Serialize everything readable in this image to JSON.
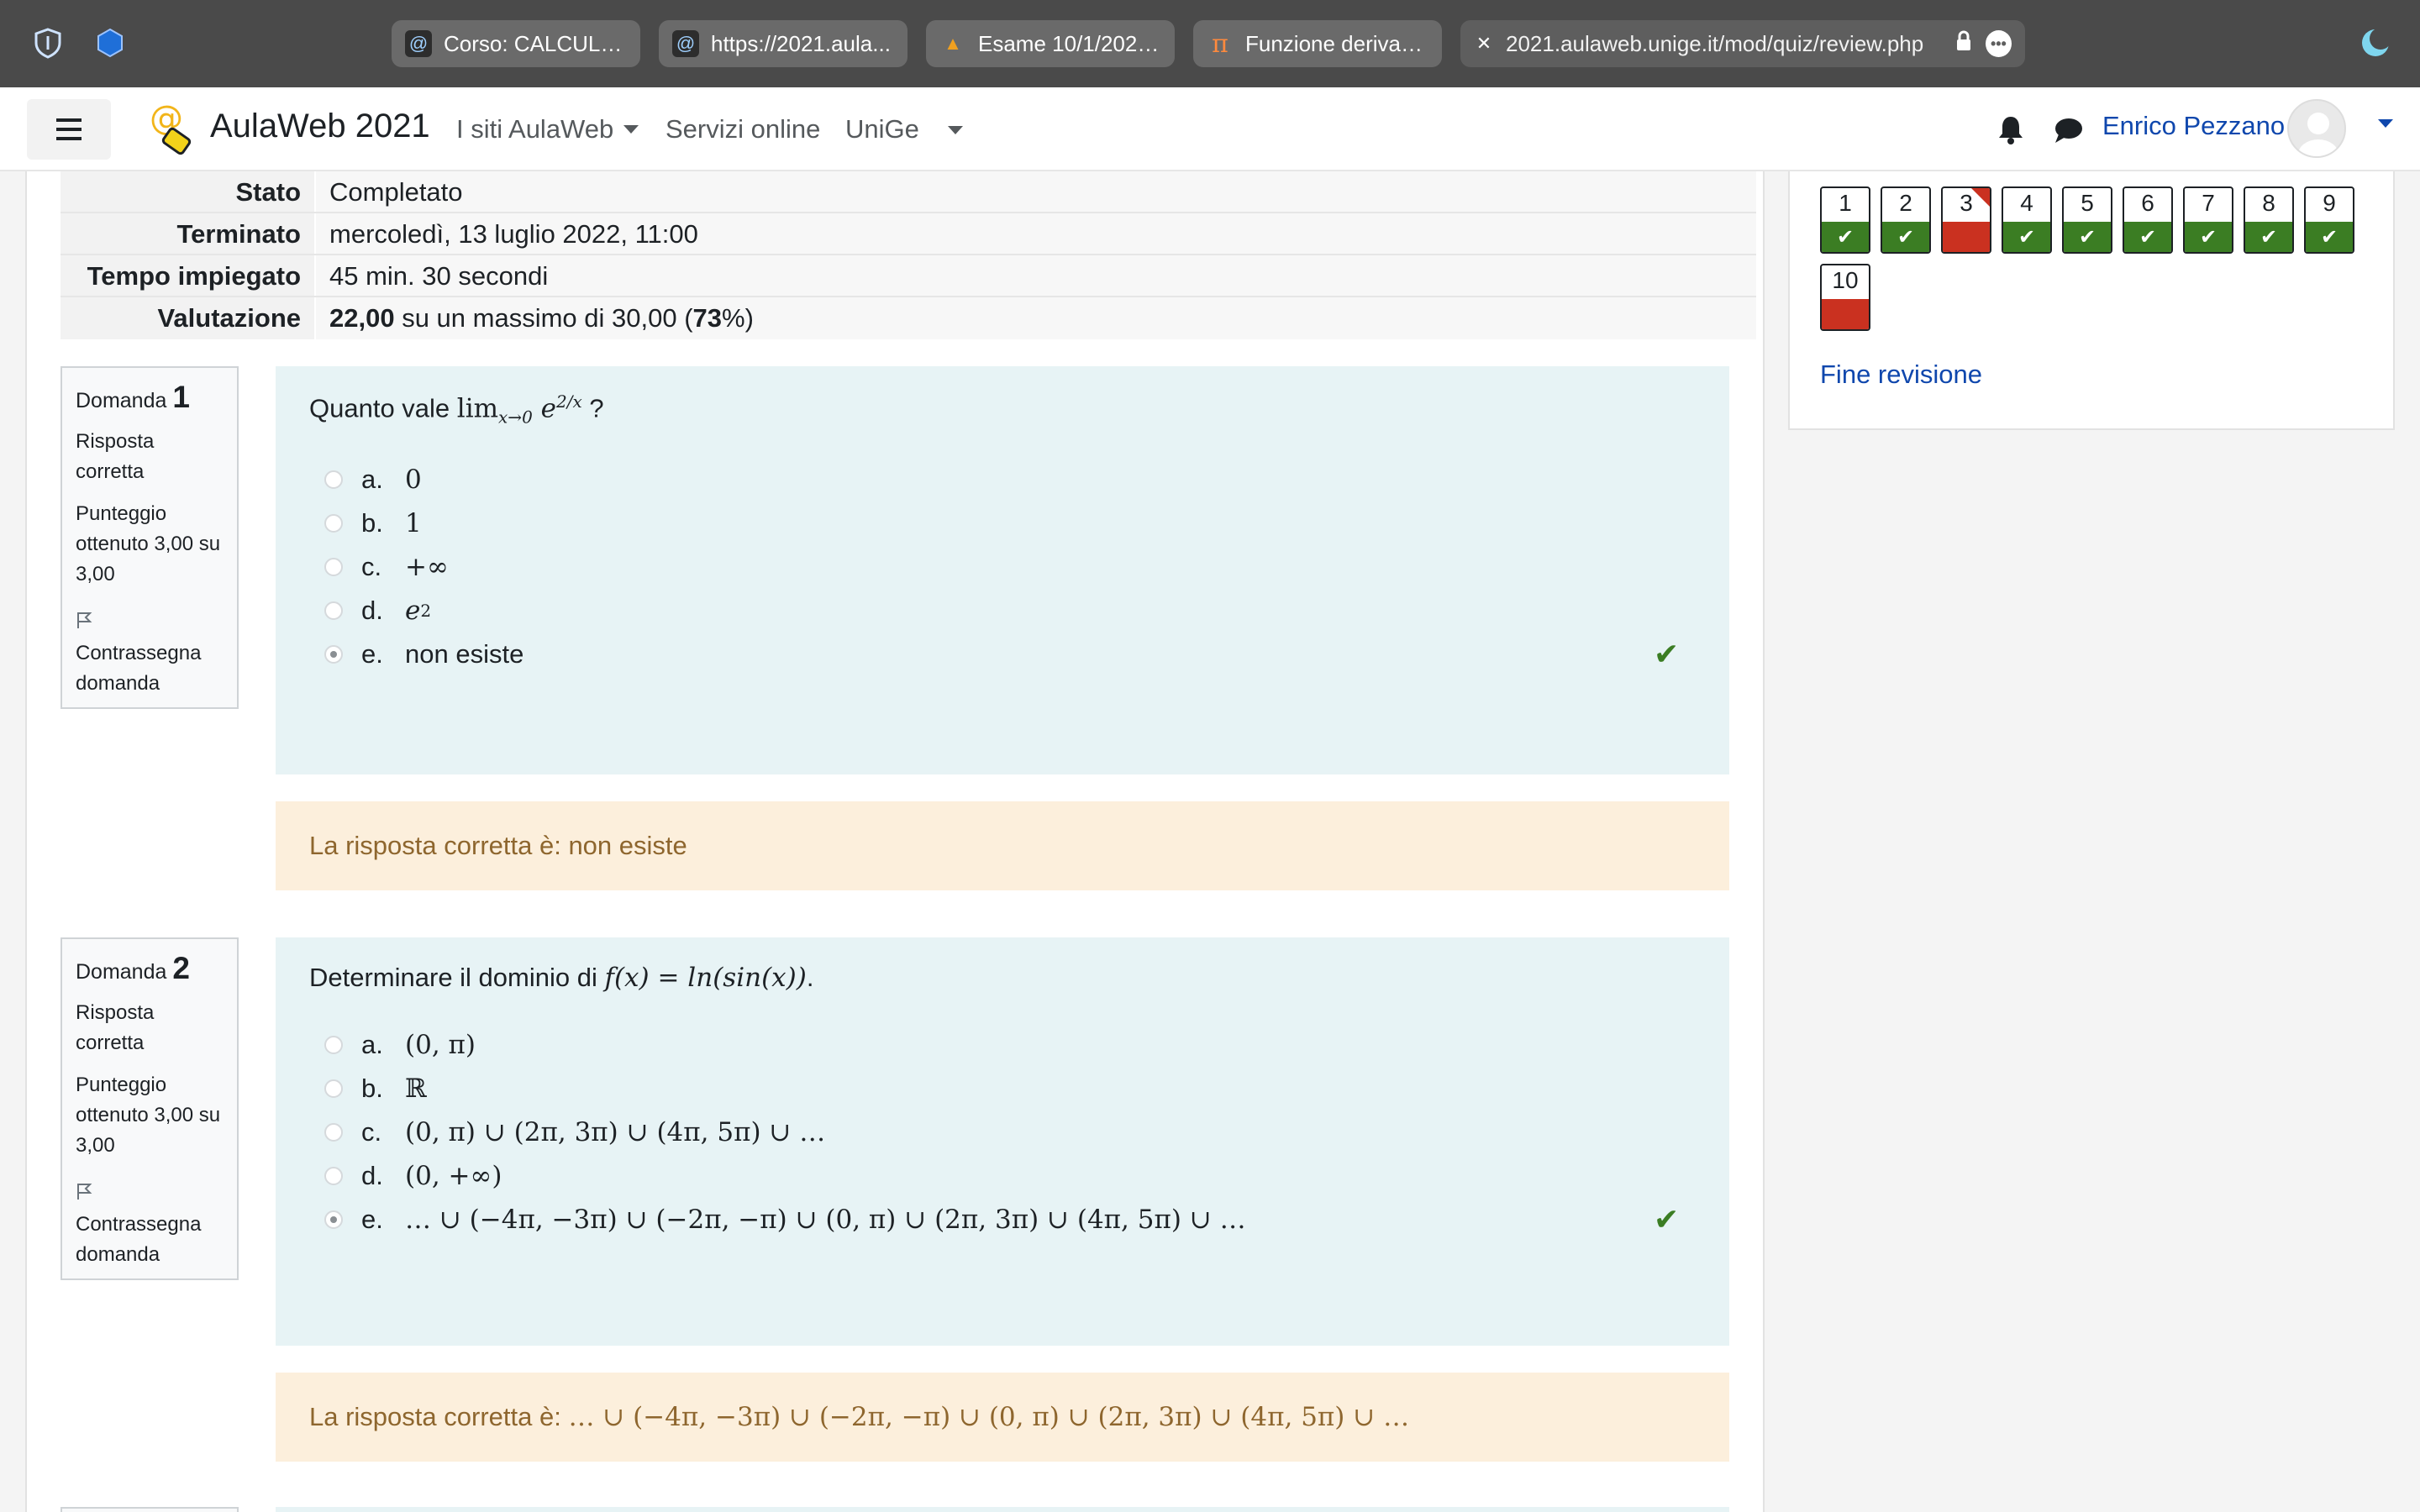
{
  "browser": {
    "tabs": [
      {
        "label": "Corso: CALCULU..."
      },
      {
        "label": "https://2021.aula..."
      },
      {
        "label": "Esame 10/1/2022..."
      },
      {
        "label": "Funzione derivabi..."
      },
      {
        "label": "2021.aulaweb.unige.it/mod/quiz/review.php"
      }
    ]
  },
  "navbar": {
    "brand": "AulaWeb 2021",
    "links": [
      "I siti AulaWeb",
      "Servizi online",
      "UniGe"
    ],
    "user": "Enrico Pezzano"
  },
  "summary": [
    {
      "label": "Stato",
      "value": "Completato"
    },
    {
      "label": "Terminato",
      "value": "mercoledì, 13 luglio 2022, 11:00"
    },
    {
      "label": "Tempo impiegato",
      "value": "45 min. 30 secondi"
    },
    {
      "label": "Valutazione",
      "score": "22,00",
      "mid": " su un massimo di 30,00 (",
      "pct": "73",
      "end": "%)"
    }
  ],
  "questions": [
    {
      "label": "Domanda",
      "number": "1",
      "status": "Risposta corretta",
      "score": "Punteggio ottenuto 3,00 su 3,00",
      "flag": "Contrassegna domanda",
      "text_prefix": "Quanto vale ",
      "text_math": "lim",
      "text_sub": "x→0",
      "text_base": " e",
      "text_sup": "2/x",
      "text_suffix": " ?",
      "options": [
        {
          "letter": "a.",
          "text": "0"
        },
        {
          "letter": "b.",
          "text": "1"
        },
        {
          "letter": "c.",
          "text": "+∞"
        },
        {
          "letter": "d.",
          "text": "e",
          "sup": "2"
        },
        {
          "letter": "e.",
          "text": "non esiste"
        }
      ],
      "feedback_prefix": "La risposta corretta è: ",
      "feedback_answer": "non esiste"
    },
    {
      "label": "Domanda",
      "number": "2",
      "status": "Risposta corretta",
      "score": "Punteggio ottenuto 3,00 su 3,00",
      "flag": "Contrassegna domanda",
      "text_prefix": "Determinare il dominio di ",
      "text_math": "f(x) = ln(sin(x))",
      "text_suffix": ".",
      "options": [
        {
          "letter": "a.",
          "text": "(0, π)"
        },
        {
          "letter": "b.",
          "text": "ℝ"
        },
        {
          "letter": "c.",
          "text": "(0, π) ∪ (2π, 3π) ∪ (4π, 5π) ∪ …"
        },
        {
          "letter": "d.",
          "text": "(0, +∞)"
        },
        {
          "letter": "e.",
          "text": "… ∪ (−4π, −3π) ∪ (−2π, −π) ∪ (0, π) ∪ (2π, 3π) ∪ (4π, 5π) ∪ …"
        }
      ],
      "feedback_prefix": "La risposta corretta è: ",
      "feedback_answer": "… ∪ (−4π, −3π) ∪ (−2π, −π) ∪ (0, π) ∪ (2π, 3π) ∪ (4π, 5π) ∪ …"
    }
  ],
  "quiz_nav": {
    "buttons": [
      {
        "n": "1",
        "state": "correct"
      },
      {
        "n": "2",
        "state": "correct"
      },
      {
        "n": "3",
        "state": "incorrect",
        "flagged": true
      },
      {
        "n": "4",
        "state": "correct"
      },
      {
        "n": "5",
        "state": "correct"
      },
      {
        "n": "6",
        "state": "correct"
      },
      {
        "n": "7",
        "state": "correct"
      },
      {
        "n": "8",
        "state": "correct"
      },
      {
        "n": "9",
        "state": "correct"
      },
      {
        "n": "10",
        "state": "incorrect"
      }
    ],
    "finish_label": "Fine revisione"
  },
  "colors": {
    "correct": "#3b7d23",
    "incorrect": "#ca3120",
    "link": "#0f47ad",
    "question_bg": "#e7f3f5",
    "feedback_bg": "#fcefdc"
  }
}
